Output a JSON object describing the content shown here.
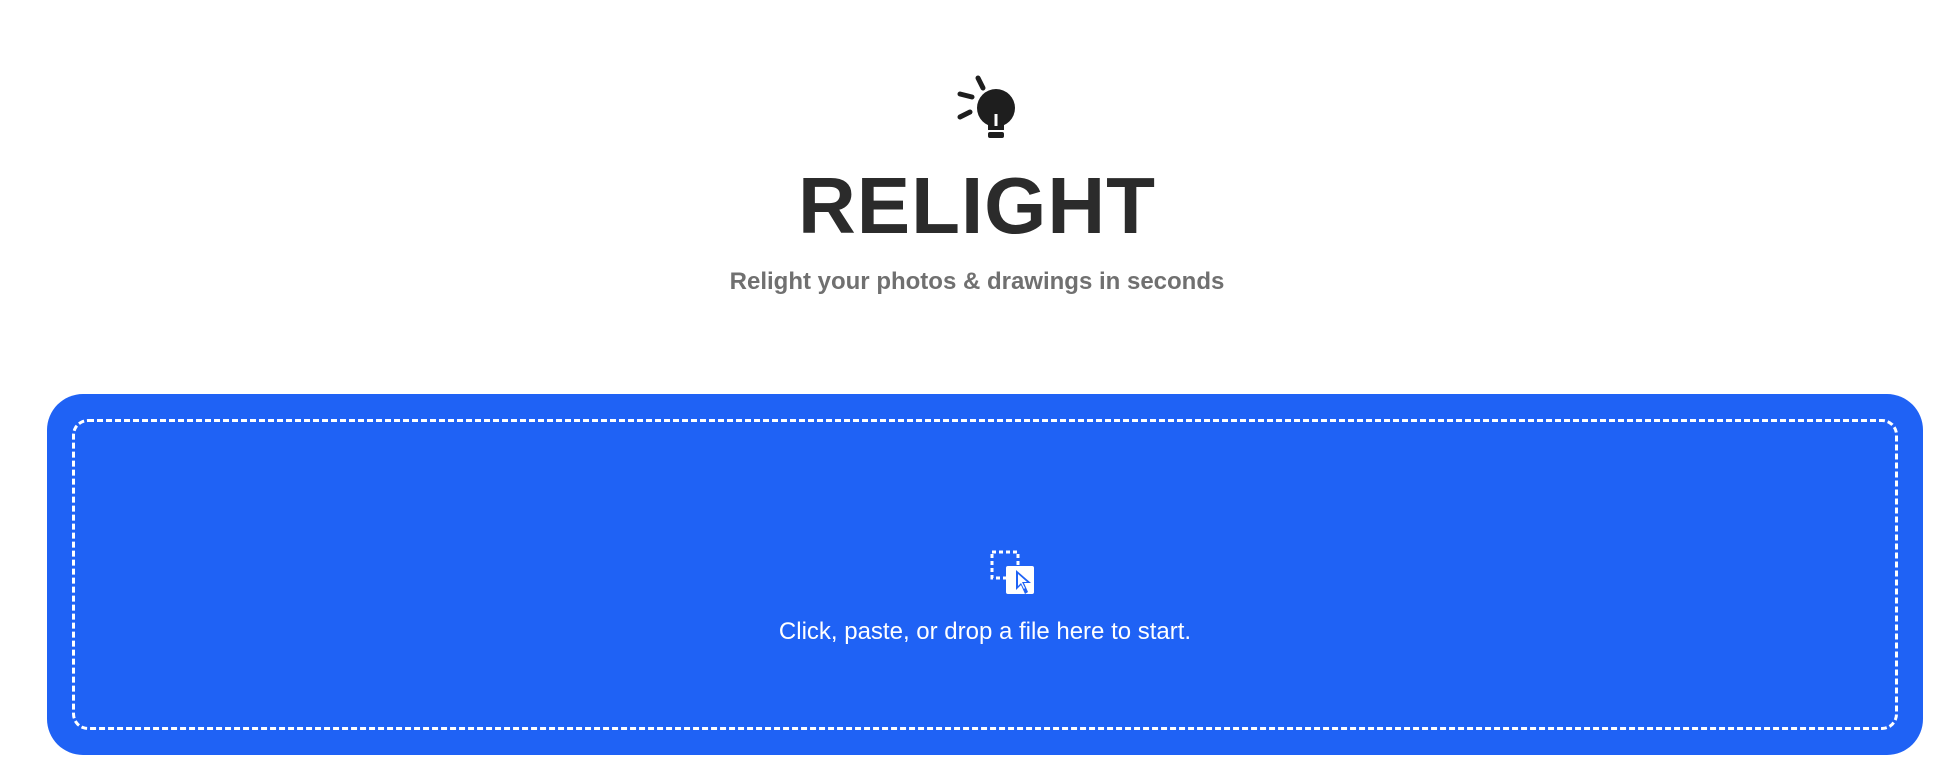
{
  "app": {
    "logo_icon": "lightbulb-icon",
    "title": "RELIGHT",
    "subtitle": "Relight your photos & drawings in seconds"
  },
  "dropzone": {
    "icon": "drag-drop-icon",
    "prompt": "Click, paste, or drop a file here to start.",
    "background_color": "#1f62f5",
    "border_color": "#ffffff"
  },
  "colors": {
    "title": "#2b2b2b",
    "subtitle": "#707070"
  }
}
